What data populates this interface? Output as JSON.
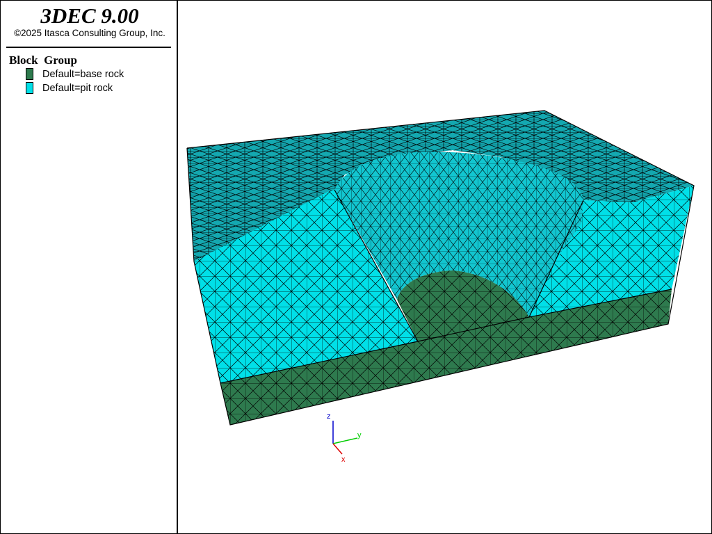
{
  "app": {
    "title": "3DEC 9.00",
    "copyright": "©2025 Itasca Consulting Group, Inc."
  },
  "legend": {
    "heading_part1": "Block",
    "heading_part2": "Group",
    "items": [
      {
        "label": "Default=base rock",
        "color": "#2e7a4e"
      },
      {
        "label": "Default=pit rock",
        "color": "#00e0e8"
      }
    ]
  },
  "colors": {
    "base_rock": "#2e7a4e",
    "pit_rock_face": "#00e0e8",
    "pit_rock_top": "#14a8b0",
    "pit_rock_wall": "#12c6d0",
    "mesh_line": "#000000"
  },
  "axes": {
    "z_label": "z",
    "y_label": "y",
    "x_label": "x",
    "z_color": "#0000cc",
    "y_color": "#00cc00",
    "x_color": "#dd0000"
  }
}
